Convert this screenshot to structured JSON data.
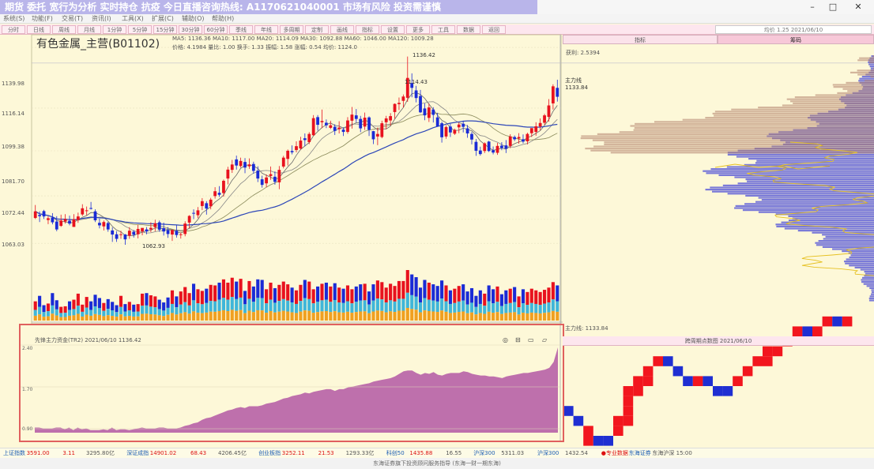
{
  "window": {
    "title": "期货  委托  宽行为分析 实时持仓 抗疫  今日直播咨询热线: A1170621040001  市场有风险  投资需谨慎",
    "minimize_label": "–",
    "maximize_label": "□",
    "close_label": "✕"
  },
  "menu": [
    "系统(S)",
    "功能(F)",
    "交易(T)",
    "资讯(I)",
    "工具(X)",
    "扩展(C)",
    "辅助(O)",
    "帮助(H)"
  ],
  "period_tabs": [
    "分时",
    "日线",
    "周线",
    "月线",
    "1分钟",
    "5分钟",
    "15分钟",
    "30分钟",
    "60分钟",
    "季线",
    "年线",
    "多周期",
    "定制",
    "画线",
    "指标",
    "设置",
    "更多",
    "工具",
    "数据",
    "返回"
  ],
  "header_info": "均价 1.25  2021/06/10",
  "stock": {
    "name": "有色金属_主营(B01102)"
  },
  "ma_legend": {
    "line1": "MA5: 1136.36   MA10: 1117.00   MA20: 1114.09   MA30: 1092.88   MA60: 1046.00   MA120: 1009.28",
    "line2": "价格: 4.1984   量比: 1.00   换手: 1.33   振幅: 1.58   涨幅: 0.54   均价: 1124.0"
  },
  "price_ticks": [
    "1139.98",
    "1116.14",
    "1099.38",
    "1081.70",
    "1072.44",
    "1063.03"
  ],
  "price_annotations": {
    "high": "1136.42",
    "high2": "1114.43",
    "low": "1062.93",
    "current": "1133.84",
    "flag": "主力线"
  },
  "right_tabs": [
    "指标",
    "筹码"
  ],
  "profile": {
    "label": "获利: 2.5394",
    "price1": "主力线",
    "price2": "1133.84",
    "bottom": "主力线: 1133.84"
  },
  "indicator": {
    "title": "先锋主力资金(TR2)  2021/06/10  1136.42",
    "icons": [
      "◎",
      "⊟",
      "▭",
      "▱"
    ],
    "ticks": [
      "2.40",
      "1.70",
      "0.90"
    ]
  },
  "pf_title": "跨周期点数图  2021/06/10",
  "status_stats": [
    {
      "text": "上证指数",
      "type": "lbl"
    },
    {
      "text": "3591.00",
      "type": "red"
    },
    {
      "text": "3.11",
      "type": "red"
    },
    {
      "text": "3295.80亿",
      "type": ""
    },
    {
      "text": "深证成指",
      "type": "lbl"
    },
    {
      "text": "14901.02",
      "type": "red"
    },
    {
      "text": "68.43",
      "type": "red"
    },
    {
      "text": "4206.45亿",
      "type": ""
    },
    {
      "text": "创业板指",
      "type": "lbl"
    },
    {
      "text": "3252.11",
      "type": "red"
    },
    {
      "text": "21.53",
      "type": "red"
    },
    {
      "text": "1293.33亿",
      "type": ""
    },
    {
      "text": "科创50",
      "type": "lbl"
    },
    {
      "text": "1435.88",
      "type": "red"
    },
    {
      "text": "16.55",
      "type": ""
    },
    {
      "text": "沪深300",
      "type": "lbl"
    },
    {
      "text": "5311.03",
      "type": ""
    },
    {
      "text": "沪深300",
      "type": "lbl"
    },
    {
      "text": "1432.54",
      "type": ""
    },
    {
      "text": "●专业数据",
      "type": "red"
    },
    {
      "text": "东海证券",
      "type": "lbl"
    },
    {
      "text": "东海沪深  15:00",
      "type": ""
    }
  ],
  "bottom_text": "东海证券旗下投资顾问服务指导 (东海一财一期东海)",
  "chart_data": {
    "type": "candlestick",
    "ohlc": [
      [
        1073.0,
        1078.1,
        1075.6,
        1072.6
      ],
      [
        1074.2,
        1075.6,
        1073.7,
        1071.4
      ],
      [
        1075.7,
        1076.2,
        1073.6,
        1072.6
      ],
      [
        1072.2,
        1073.7,
        1072.9,
        1070.6
      ],
      [
        1073.2,
        1074.9,
        1071.3,
        1070.5
      ],
      [
        1071.6,
        1073.7,
        1068.5,
        1067.8
      ],
      [
        1069.9,
        1074.3,
        1072.0,
        1069.5
      ],
      [
        1071.6,
        1074.5,
        1072.6,
        1070.8
      ],
      [
        1071.9,
        1073.9,
        1070.8,
        1070.1
      ],
      [
        1069.5,
        1074.5,
        1072.5,
        1069.5
      ],
      [
        1072.2,
        1075.1,
        1073.6,
        1071.1
      ],
      [
        1074.4,
        1078.4,
        1076.8,
        1073.8
      ],
      [
        1075.7,
        1077.5,
        1076.0,
        1074.1
      ],
      [
        1076.9,
        1079.3,
        1076.7,
        1076.3
      ],
      [
        1075.6,
        1076.4,
        1072.1,
        1071.4
      ],
      [
        1071.1,
        1072.7,
        1070.1,
        1068.9
      ],
      [
        1069.7,
        1072.0,
        1071.4,
        1068.1
      ],
      [
        1071.0,
        1071.5,
        1068.5,
        1067.6
      ],
      [
        1068.1,
        1069.3,
        1066.5,
        1063.6
      ],
      [
        1066.6,
        1067.8,
        1064.8,
        1063.6
      ],
      [
        1066.5,
        1068.0,
        1066.6,
        1064.8
      ],
      [
        1066.5,
        1066.7,
        1064.6,
        1062.5
      ],
      [
        1066.0,
        1069.4,
        1068.0,
        1064.8
      ],
      [
        1067.6,
        1068.3,
        1066.4,
        1065.3
      ],
      [
        1066.6,
        1070.3,
        1068.7,
        1065.0
      ],
      [
        1067.7,
        1068.9,
        1069.1,
        1066.2
      ],
      [
        1068.5,
        1069.4,
        1067.7,
        1066.6
      ],
      [
        1068.5,
        1071.3,
        1069.1,
        1067.4
      ],
      [
        1069.4,
        1072.3,
        1070.9,
        1067.8
      ],
      [
        1071.3,
        1072.0,
        1068.4,
        1067.6
      ],
      [
        1069.0,
        1071.2,
        1067.7,
        1066.1
      ],
      [
        1068.2,
        1069.4,
        1066.7,
        1065.2
      ],
      [
        1066.5,
        1068.3,
        1068.3,
        1064.0
      ],
      [
        1068.0,
        1070.1,
        1066.3,
        1065.3
      ],
      [
        1066.4,
        1067.3,
        1066.6,
        1064.9
      ],
      [
        1066.7,
        1071.7,
        1070.8,
        1065.8
      ],
      [
        1071.2,
        1074.1,
        1073.8,
        1069.0
      ],
      [
        1075.0,
        1076.4,
        1074.8,
        1072.6
      ],
      [
        1074.1,
        1077.3,
        1076.0,
        1072.9
      ],
      [
        1077.7,
        1080.8,
        1079.6,
        1076.1
      ],
      [
        1078.8,
        1079.6,
        1076.7,
        1074.3
      ],
      [
        1077.6,
        1080.9,
        1080.2,
        1076.4
      ],
      [
        1081.6,
        1085.1,
        1083.5,
        1080.6
      ],
      [
        1082.9,
        1085.5,
        1082.1,
        1081.3
      ],
      [
        1082.8,
        1088.1,
        1087.6,
        1081.4
      ],
      [
        1088.5,
        1093.1,
        1092.0,
        1086.2
      ],
      [
        1091.9,
        1095.8,
        1094.0,
        1090.7
      ],
      [
        1096.0,
        1097.5,
        1093.6,
        1092.0
      ],
      [
        1093.4,
        1096.7,
        1095.4,
        1092.8
      ],
      [
        1095.0,
        1096.5,
        1092.8,
        1090.6
      ],
      [
        1093.3,
        1096.4,
        1094.0,
        1092.3
      ],
      [
        1094.2,
        1095.1,
        1091.5,
        1090.4
      ],
      [
        1091.6,
        1093.3,
        1088.5,
        1087.1
      ],
      [
        1088.2,
        1089.6,
        1086.0,
        1084.9
      ],
      [
        1086.6,
        1090.1,
        1088.9,
        1085.1
      ],
      [
        1089.5,
        1093.2,
        1090.2,
        1088.0
      ],
      [
        1089.2,
        1091.3,
        1087.2,
        1086.1
      ],
      [
        1087.0,
        1093.4,
        1091.9,
        1084.3
      ],
      [
        1093.2,
        1097.4,
        1096.7,
        1092.5
      ],
      [
        1096.2,
        1099.9,
        1099.4,
        1093.6
      ],
      [
        1099.3,
        1101.5,
        1098.8,
        1098.0
      ],
      [
        1099.7,
        1103.1,
        1101.2,
        1098.8
      ],
      [
        1100.3,
        1104.9,
        1103.4,
        1099.8
      ],
      [
        1104.3,
        1106.2,
        1103.6,
        1101.2
      ],
      [
        1102.8,
        1106.7,
        1106.0,
        1102.0
      ],
      [
        1105.5,
        1113.4,
        1112.2,
        1105.3
      ],
      [
        1112.6,
        1113.4,
        1109.6,
        1107.3
      ],
      [
        1110.6,
        1115.6,
        1111.1,
        1108.3
      ],
      [
        1110.4,
        1111.7,
        1109.4,
        1108.3
      ],
      [
        1108.4,
        1111.2,
        1109.4,
        1107.9
      ],
      [
        1108.8,
        1109.8,
        1107.2,
        1105.6
      ],
      [
        1107.9,
        1111.0,
        1108.5,
        1106.2
      ],
      [
        1107.7,
        1108.6,
        1106.8,
        1105.2
      ],
      [
        1106.8,
        1112.6,
        1111.3,
        1106.1
      ],
      [
        1111.2,
        1116.6,
        1113.6,
        1108.1
      ],
      [
        1113.3,
        1115.8,
        1111.9,
        1110.6
      ],
      [
        1111.9,
        1113.1,
        1108.2,
        1106.7
      ],
      [
        1108.9,
        1114.4,
        1112.4,
        1107.6
      ],
      [
        1112.5,
        1112.9,
        1107.6,
        1105.2
      ],
      [
        1107.1,
        1107.2,
        1103.9,
        1102.0
      ],
      [
        1105.0,
        1108.5,
        1106.0,
        1101.6
      ],
      [
        1104.8,
        1111.2,
        1110.2,
        1104.3
      ],
      [
        1110.6,
        1113.1,
        1112.1,
        1107.9
      ],
      [
        1111.3,
        1114.2,
        1113.0,
        1109.3
      ],
      [
        1114.6,
        1118.0,
        1117.8,
        1112.0
      ],
      [
        1117.7,
        1120.3,
        1118.2,
        1115.4
      ],
      [
        1119.0,
        1121.5,
        1120.7,
        1116.4
      ],
      [
        1120.2,
        1136.4,
        1128.0,
        1118.6
      ],
      [
        1126.0,
        1129.8,
        1124.1,
        1120.4
      ],
      [
        1123.1,
        1124.9,
        1120.1,
        1118.4
      ],
      [
        1120.9,
        1123.3,
        1114.5,
        1114.2
      ],
      [
        1116.0,
        1118.0,
        1113.3,
        1111.4
      ],
      [
        1112.3,
        1118.0,
        1116.4,
        1110.7
      ],
      [
        1115.6,
        1116.5,
        1113.5,
        1110.5
      ],
      [
        1112.5,
        1114.3,
        1109.0,
        1108.8
      ],
      [
        1110.2,
        1110.8,
        1104.7,
        1102.6
      ],
      [
        1105.0,
        1109.4,
        1108.7,
        1104.1
      ],
      [
        1108.9,
        1110.0,
        1106.6,
        1104.8
      ],
      [
        1106.1,
        1108.1,
        1107.6,
        1105.6
      ],
      [
        1108.6,
        1110.5,
        1109.7,
        1106.3
      ],
      [
        1110.0,
        1111.2,
        1108.8,
        1106.6
      ],
      [
        1108.2,
        1109.5,
        1106.2,
        1104.5
      ],
      [
        1106.0,
        1106.8,
        1103.8,
        1101.9
      ],
      [
        1102.9,
        1104.0,
        1099.4,
        1097.4
      ],
      [
        1099.5,
        1101.0,
        1098.1,
        1097.5
      ],
      [
        1099.3,
        1102.7,
        1102.3,
        1098.5
      ],
      [
        1103.0,
        1103.3,
        1099.3,
        1098.9
      ],
      [
        1099.6,
        1101.1,
        1098.7,
        1098.0
      ],
      [
        1098.6,
        1102.5,
        1101.3,
        1097.8
      ],
      [
        1101.4,
        1102.8,
        1100.5,
        1099.6
      ],
      [
        1101.5,
        1103.6,
        1100.2,
        1098.5
      ],
      [
        1101.3,
        1105.9,
        1105.0,
        1100.4
      ],
      [
        1104.8,
        1105.4,
        1103.9,
        1103.2
      ],
      [
        1104.2,
        1106.3,
        1104.8,
        1102.2
      ],
      [
        1103.9,
        1105.8,
        1103.0,
        1102.3
      ],
      [
        1103.1,
        1106.5,
        1106.0,
        1101.9
      ],
      [
        1106.3,
        1107.8,
        1108.3,
        1104.8
      ],
      [
        1106.8,
        1110.6,
        1109.0,
        1105.3
      ],
      [
        1108.9,
        1112.1,
        1110.3,
        1107.5
      ],
      [
        1110.4,
        1113.9,
        1113.3,
        1109.6
      ],
      [
        1112.7,
        1119.7,
        1117.2,
        1110.8
      ],
      [
        1118.0,
        1125.5,
        1124.7,
        1115.6
      ],
      [
        1124.1,
        1127.3,
        1120.6,
        1118.7
      ]
    ],
    "volume": [
      35,
      45,
      28,
      31,
      50,
      37,
      25,
      26,
      35,
      38,
      49,
      29,
      43,
      35,
      47,
      41,
      32,
      39,
      34,
      28,
      45,
      30,
      34,
      29,
      30,
      49,
      50,
      46,
      44,
      38,
      33,
      42,
      55,
      44,
      53,
      61,
      50,
      67,
      57,
      54,
      58,
      65,
      64,
      69,
      75,
      69,
      78,
      71,
      76,
      54,
      72,
      62,
      75,
      74,
      57,
      69,
      59,
      65,
      71,
      66,
      60,
      55,
      65,
      74,
      71,
      57,
      62,
      67,
      69,
      62,
      68,
      60,
      58,
      64,
      57,
      62,
      66,
      67,
      53,
      66,
      73,
      70,
      60,
      67,
      63,
      72,
      72,
      92,
      84,
      79,
      60,
      74,
      69,
      66,
      63,
      73,
      64,
      55,
      58,
      63,
      66,
      53,
      59,
      45,
      55,
      49,
      64,
      57,
      62,
      48,
      55,
      58,
      61,
      44,
      57,
      52,
      58,
      55,
      52,
      56,
      60,
      70,
      64
    ],
    "indicator_values": [
      6,
      6,
      5,
      5,
      5,
      6,
      6,
      4,
      6,
      3,
      6,
      4,
      5,
      3,
      3,
      3,
      4,
      3,
      6,
      3,
      4,
      4,
      3,
      4,
      5,
      6,
      5,
      5,
      5,
      6,
      6,
      5,
      5,
      5,
      6,
      8,
      9,
      11,
      12,
      15,
      17,
      18,
      20,
      22,
      24,
      26,
      27,
      29,
      30,
      29,
      31,
      31,
      31,
      32,
      34,
      35,
      36,
      38,
      40,
      41,
      43,
      44,
      45,
      47,
      46,
      48,
      49,
      50,
      51,
      51,
      49,
      51,
      51,
      53,
      54,
      55,
      56,
      57,
      58,
      60,
      61,
      62,
      63,
      64,
      66,
      69,
      72,
      73,
      73,
      70,
      68,
      70,
      69,
      71,
      68,
      67,
      69,
      70,
      70,
      70,
      72,
      71,
      69,
      68,
      67,
      67,
      66,
      66,
      65,
      64,
      66,
      67,
      68,
      69,
      70,
      70,
      71,
      72,
      73,
      74,
      76,
      83,
      100
    ]
  },
  "pf_grid": [
    [
      0,
      3,
      "b"
    ],
    [
      1,
      2,
      "b"
    ],
    [
      2,
      0,
      "r"
    ],
    [
      2,
      1,
      "r"
    ],
    [
      3,
      0,
      "b"
    ],
    [
      4,
      0,
      "b"
    ],
    [
      5,
      1,
      "r"
    ],
    [
      5,
      2,
      "r"
    ],
    [
      6,
      2,
      "r"
    ],
    [
      6,
      3,
      "r"
    ],
    [
      6,
      4,
      "r"
    ],
    [
      6,
      5,
      "r"
    ],
    [
      7,
      5,
      "r"
    ],
    [
      7,
      6,
      "r"
    ],
    [
      8,
      6,
      "r"
    ],
    [
      8,
      7,
      "r"
    ],
    [
      9,
      8,
      "r"
    ],
    [
      10,
      8,
      "b"
    ],
    [
      11,
      7,
      "b"
    ],
    [
      12,
      6,
      "b"
    ],
    [
      13,
      6,
      "r"
    ],
    [
      14,
      6,
      "b"
    ],
    [
      15,
      5,
      "b"
    ],
    [
      16,
      5,
      "b"
    ],
    [
      17,
      6,
      "r"
    ],
    [
      18,
      7,
      "r"
    ],
    [
      19,
      8,
      "r"
    ],
    [
      20,
      8,
      "r"
    ],
    [
      20,
      9,
      "r"
    ],
    [
      21,
      9,
      "r"
    ],
    [
      22,
      10,
      "r"
    ],
    [
      23,
      11,
      "r"
    ],
    [
      24,
      11,
      "b"
    ],
    [
      25,
      11,
      "r"
    ],
    [
      26,
      12,
      "r"
    ],
    [
      27,
      12,
      "b"
    ],
    [
      28,
      12,
      "r"
    ]
  ]
}
